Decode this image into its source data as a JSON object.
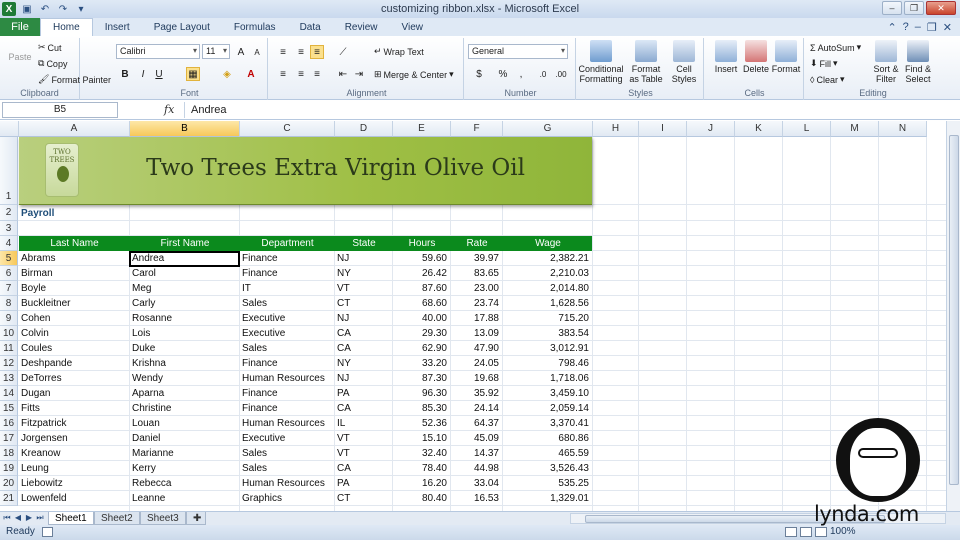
{
  "window": {
    "title": "customizing ribbon.xlsx - Microsoft Excel",
    "app_icon": "X",
    "qat_icons": [
      "save-icon",
      "undo-icon",
      "redo-icon",
      "customize-qat-icon"
    ]
  },
  "ribbon": {
    "file_tab": "File",
    "tabs": [
      "Home",
      "Insert",
      "Page Layout",
      "Formulas",
      "Data",
      "Review",
      "View"
    ],
    "active_tab": "Home",
    "clipboard": {
      "paste": "Paste",
      "cut": "Cut",
      "copy": "Copy",
      "format_painter": "Format Painter",
      "label": "Clipboard"
    },
    "font": {
      "name": "Calibri",
      "size": "11",
      "bold": "B",
      "italic": "I",
      "underline": "U",
      "label": "Font"
    },
    "alignment": {
      "wrap_text": "Wrap Text",
      "merge_center": "Merge & Center",
      "label": "Alignment"
    },
    "number": {
      "format": "General",
      "currency": "$",
      "percent": "%",
      "comma": ",",
      "label": "Number"
    },
    "styles": {
      "conditional_1": "Conditional",
      "conditional_2": "Formatting",
      "format_1": "Format",
      "format_2": "as Table",
      "cell_1": "Cell",
      "cell_2": "Styles",
      "label": "Styles"
    },
    "cells": {
      "insert": "Insert",
      "delete": "Delete",
      "format": "Format",
      "label": "Cells"
    },
    "editing": {
      "autosum": "AutoSum",
      "fill": "Fill",
      "clear": "Clear",
      "sort_1": "Sort &",
      "sort_2": "Filter",
      "find_1": "Find &",
      "find_2": "Select",
      "label": "Editing"
    }
  },
  "formula_bar": {
    "name_box": "B5",
    "fx": "fx",
    "content": "Andrea"
  },
  "columns": [
    "A",
    "B",
    "C",
    "D",
    "E",
    "F",
    "G",
    "H",
    "I",
    "J",
    "K",
    "L",
    "M",
    "N"
  ],
  "selected_column": "B",
  "selected_row": "5",
  "row_numbers": [
    "1",
    "2",
    "3",
    "4",
    "5",
    "6",
    "7",
    "8",
    "9",
    "10",
    "11",
    "12",
    "13",
    "14",
    "15",
    "16",
    "17",
    "18",
    "19",
    "20",
    "21"
  ],
  "sheet": {
    "banner_title": "Two Trees Extra Virgin Olive Oil",
    "logo_text": "TWO TREES",
    "section_label": "Payroll",
    "headers": [
      "Last Name",
      "First Name",
      "Department",
      "State",
      "Hours",
      "Rate",
      "Wage"
    ],
    "rows": [
      [
        "Abrams",
        "Andrea",
        "Finance",
        "NJ",
        "59.60",
        "39.97",
        "2,382.21"
      ],
      [
        "Birman",
        "Carol",
        "Finance",
        "NY",
        "26.42",
        "83.65",
        "2,210.03"
      ],
      [
        "Boyle",
        "Meg",
        "IT",
        "VT",
        "87.60",
        "23.00",
        "2,014.80"
      ],
      [
        "Buckleitner",
        "Carly",
        "Sales",
        "CT",
        "68.60",
        "23.74",
        "1,628.56"
      ],
      [
        "Cohen",
        "Rosanne",
        "Executive",
        "NJ",
        "40.00",
        "17.88",
        "715.20"
      ],
      [
        "Colvin",
        "Lois",
        "Executive",
        "CA",
        "29.30",
        "13.09",
        "383.54"
      ],
      [
        "Coules",
        "Duke",
        "Sales",
        "CA",
        "62.90",
        "47.90",
        "3,012.91"
      ],
      [
        "Deshpande",
        "Krishna",
        "Finance",
        "NY",
        "33.20",
        "24.05",
        "798.46"
      ],
      [
        "DeTorres",
        "Wendy",
        "Human Resources",
        "NJ",
        "87.30",
        "19.68",
        "1,718.06"
      ],
      [
        "Dugan",
        "Aparna",
        "Finance",
        "PA",
        "96.30",
        "35.92",
        "3,459.10"
      ],
      [
        "Fitts",
        "Christine",
        "Finance",
        "CA",
        "85.30",
        "24.14",
        "2,059.14"
      ],
      [
        "Fitzpatrick",
        "Louan",
        "Human Resources",
        "IL",
        "52.36",
        "64.37",
        "3,370.41"
      ],
      [
        "Jorgensen",
        "Daniel",
        "Executive",
        "VT",
        "15.10",
        "45.09",
        "680.86"
      ],
      [
        "Kreanow",
        "Marianne",
        "Sales",
        "VT",
        "32.40",
        "14.37",
        "465.59"
      ],
      [
        "Leung",
        "Kerry",
        "Sales",
        "CA",
        "78.40",
        "44.98",
        "3,526.43"
      ],
      [
        "Liebowitz",
        "Rebecca",
        "Human Resources",
        "PA",
        "16.20",
        "33.04",
        "535.25"
      ],
      [
        "Lowenfeld",
        "Leanne",
        "Graphics",
        "CT",
        "80.40",
        "16.53",
        "1,329.01"
      ]
    ]
  },
  "sheet_tabs": [
    "Sheet1",
    "Sheet2",
    "Sheet3"
  ],
  "active_sheet": "Sheet1",
  "status": {
    "ready": "Ready",
    "zoom": "100%"
  },
  "watermark": "lynda.com",
  "colors": {
    "header_green": "#0b8a1d",
    "file_tab": "#2d8a43",
    "banner_green": "#9fbf45",
    "selection": "#f7c85a"
  }
}
